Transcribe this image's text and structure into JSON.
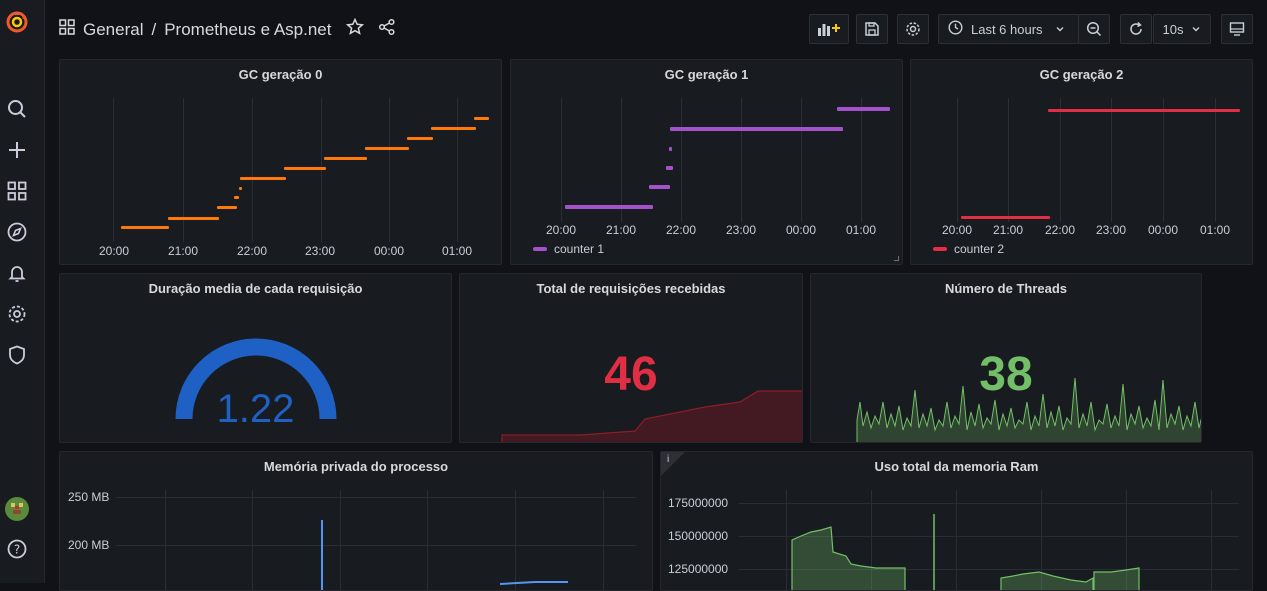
{
  "breadcrumb": {
    "folder": "General",
    "separator": "/",
    "dashboard": "Prometheus e Asp.net"
  },
  "toolbar": {
    "time_range": "Last 6 hours",
    "refresh_interval": "10s"
  },
  "colors": {
    "orange": "#ff780a",
    "purple": "#a352cc",
    "red": "#e02f44",
    "blue": "#1f60c4",
    "green": "#73bf69",
    "accent": "#f05a28"
  },
  "time_ticks_a": [
    "20:00",
    "21:00",
    "22:00",
    "23:00",
    "00:00",
    "01:00"
  ],
  "time_ticks_b": [
    "20:00",
    "21:00",
    "22:00",
    "23:00",
    "00:00",
    "01:00"
  ],
  "time_ticks_c": [
    "20:00",
    "21:00",
    "22:00",
    "23:00",
    "00:00",
    "01:00"
  ],
  "panels": {
    "gc0": {
      "title": "GC geração 0"
    },
    "gc1": {
      "title": "GC geração 1",
      "legend": "counter 1"
    },
    "gc2": {
      "title": "GC geração 2",
      "legend": "counter 2"
    },
    "duracao": {
      "title": "Duração media de cada requisição",
      "value": "1.22",
      "gauge_fraction": 0.6
    },
    "total": {
      "title": "Total de requisições recebidas",
      "value": "46"
    },
    "threads": {
      "title": "Número de Threads",
      "value": "38"
    },
    "memoria": {
      "title": "Memória privada do processo",
      "y_ticks": [
        "250 MB",
        "200 MB"
      ]
    },
    "ram": {
      "title": "Uso total da memoria Ram",
      "y_ticks": [
        "175000000",
        "150000000",
        "125000000"
      ],
      "info": "i"
    }
  }
}
